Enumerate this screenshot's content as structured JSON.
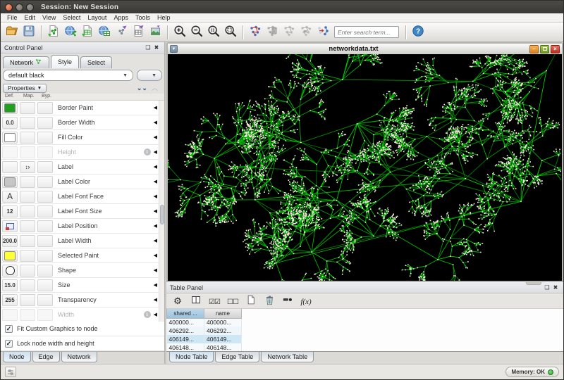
{
  "window": {
    "title": "Session: New Session"
  },
  "menu_bar": {
    "items": [
      "File",
      "Edit",
      "View",
      "Select",
      "Layout",
      "Apps",
      "Tools",
      "Help"
    ]
  },
  "toolbar": {
    "search_placeholder": "Enter search term...",
    "buttons": [
      {
        "name": "open-session-button",
        "icon": "open-folder"
      },
      {
        "name": "save-session-button",
        "icon": "save"
      },
      {
        "sep": true
      },
      {
        "name": "import-network-file-button",
        "icon": "import-network-file"
      },
      {
        "name": "import-network-url-button",
        "icon": "import-network-url"
      },
      {
        "name": "import-table-file-button",
        "icon": "import-table-file"
      },
      {
        "name": "import-table-url-button",
        "icon": "import-table-url"
      },
      {
        "name": "export-network-button",
        "icon": "export-network"
      },
      {
        "name": "export-table-button",
        "icon": "export-table"
      },
      {
        "name": "export-image-button",
        "icon": "export-image"
      },
      {
        "sep": true
      },
      {
        "name": "zoom-in-button",
        "icon": "zoom-in"
      },
      {
        "name": "zoom-out-button",
        "icon": "zoom-out"
      },
      {
        "name": "zoom-fit-button",
        "icon": "zoom-fit"
      },
      {
        "name": "zoom-selected-button",
        "icon": "zoom-selected"
      },
      {
        "sep": true
      },
      {
        "name": "apply-layout-button",
        "icon": "layout-colored"
      },
      {
        "name": "layout-tool-1-button",
        "icon": "layout-gray-1"
      },
      {
        "name": "layout-tool-2-button",
        "icon": "layout-gray-2"
      },
      {
        "name": "layout-tool-3-button",
        "icon": "layout-gray-3"
      },
      {
        "name": "layout-tool-4-button",
        "icon": "layout-gray-4"
      },
      {
        "search": true
      },
      {
        "sep": true
      },
      {
        "name": "help-button",
        "icon": "help"
      }
    ]
  },
  "control_panel": {
    "title": "Control Panel",
    "tabs": [
      {
        "label": "Network",
        "icon": "network-mini"
      },
      {
        "label": "Style",
        "active": true
      },
      {
        "label": "Select"
      }
    ],
    "style_dropdown_value": "default black",
    "properties_menu_label": "Properties",
    "column_headers": [
      "Def.",
      "Map.",
      "Byp."
    ],
    "properties": [
      {
        "label": "Border Paint",
        "def_type": "swatch",
        "def_color": "#1fa11f"
      },
      {
        "label": "Border Width",
        "def_type": "text",
        "def_value": "0.0"
      },
      {
        "label": "Fill Color",
        "def_type": "swatch",
        "def_color": "#ffffff"
      },
      {
        "label": "Height",
        "def_type": "none",
        "disabled": true
      },
      {
        "label": "Label",
        "def_type": "none",
        "map_type": "passthrough"
      },
      {
        "label": "Label Color",
        "def_type": "swatch",
        "def_color": "#c6c6c6"
      },
      {
        "label": "Label Font Face",
        "def_type": "font",
        "def_value": "A"
      },
      {
        "label": "Label Font Size",
        "def_type": "text",
        "def_value": "12"
      },
      {
        "label": "Label Position",
        "def_type": "position"
      },
      {
        "label": "Label Width",
        "def_type": "text",
        "def_value": "200.0"
      },
      {
        "label": "Selected Paint",
        "def_type": "swatch",
        "def_color": "#ffff33"
      },
      {
        "label": "Shape",
        "def_type": "ellipse"
      },
      {
        "label": "Size",
        "def_type": "text",
        "def_value": "15.0"
      },
      {
        "label": "Transparency",
        "def_type": "text",
        "def_value": "255"
      },
      {
        "label": "Width",
        "def_type": "none",
        "disabled": true
      }
    ],
    "checkboxes": [
      {
        "label": "Fit Custom Graphics to node",
        "checked": true
      },
      {
        "label": "Lock node width and height",
        "checked": true
      }
    ],
    "bottom_tabs": [
      {
        "label": "Node",
        "active": true
      },
      {
        "label": "Edge"
      },
      {
        "label": "Network"
      }
    ]
  },
  "network_window": {
    "title": "networkdata.txt",
    "graph": {
      "background": "#000000",
      "edge_colors": [
        "#007c00",
        "#009600",
        "#00b000",
        "#00c800"
      ],
      "node_color": "#ffe2e6",
      "seed": 21
    }
  },
  "table_panel": {
    "title": "Table Panel",
    "toolbar_icons": [
      {
        "name": "table-settings-button",
        "icon": "gear"
      },
      {
        "name": "table-columns-button",
        "icon": "columns"
      },
      {
        "name": "select-all-button",
        "icon": "select-all"
      },
      {
        "name": "deselect-all-button",
        "icon": "deselect-all"
      },
      {
        "name": "new-column-button",
        "icon": "new-doc"
      },
      {
        "name": "delete-column-button",
        "icon": "trash"
      },
      {
        "name": "rename-column-button",
        "icon": "rename"
      },
      {
        "name": "function-builder-button",
        "icon": "fx"
      }
    ],
    "columns": [
      {
        "label": "shared ...",
        "selected": true
      },
      {
        "label": "name"
      }
    ],
    "rows": [
      [
        "400000...",
        "400000..."
      ],
      [
        "406292...",
        "406292..."
      ],
      [
        "406149...",
        "406149..."
      ],
      [
        "406148...",
        "406148..."
      ]
    ],
    "tabs": [
      {
        "label": "Node Table",
        "active": true
      },
      {
        "label": "Edge Table"
      },
      {
        "label": "Network Table"
      }
    ]
  },
  "status_bar": {
    "memory_label": "Memory: OK"
  }
}
